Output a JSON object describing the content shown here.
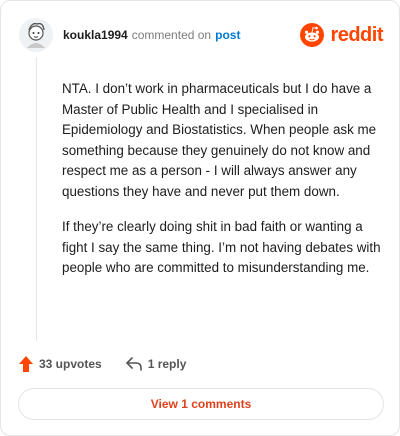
{
  "comment": {
    "username": "koukla1994",
    "action": "commented on",
    "post_link": "post",
    "paragraphs": [
      "NTA. I don’t work in pharmaceuticals but I do have a Master of Public Health and I specialised in Epidemiology and Biostatistics. When people ask me something because they genuinely do not know and respect me as a person - I will always answer any questions they have and never put them down.",
      "If they’re clearly doing shit in bad faith or wanting a fight I say the same thing. I’m not having debates with people who are committed to misunderstanding me."
    ],
    "upvotes_label": "33 upvotes",
    "reply_label": "1 reply"
  },
  "brand": {
    "name": "reddit",
    "color": "#ff4500"
  },
  "view_comments_label": "View 1 comments",
  "icons": {
    "avatar": "avatar-icon",
    "logo": "reddit-logo-icon",
    "upvote": "upvote-arrow-icon",
    "reply": "reply-arrow-icon"
  }
}
